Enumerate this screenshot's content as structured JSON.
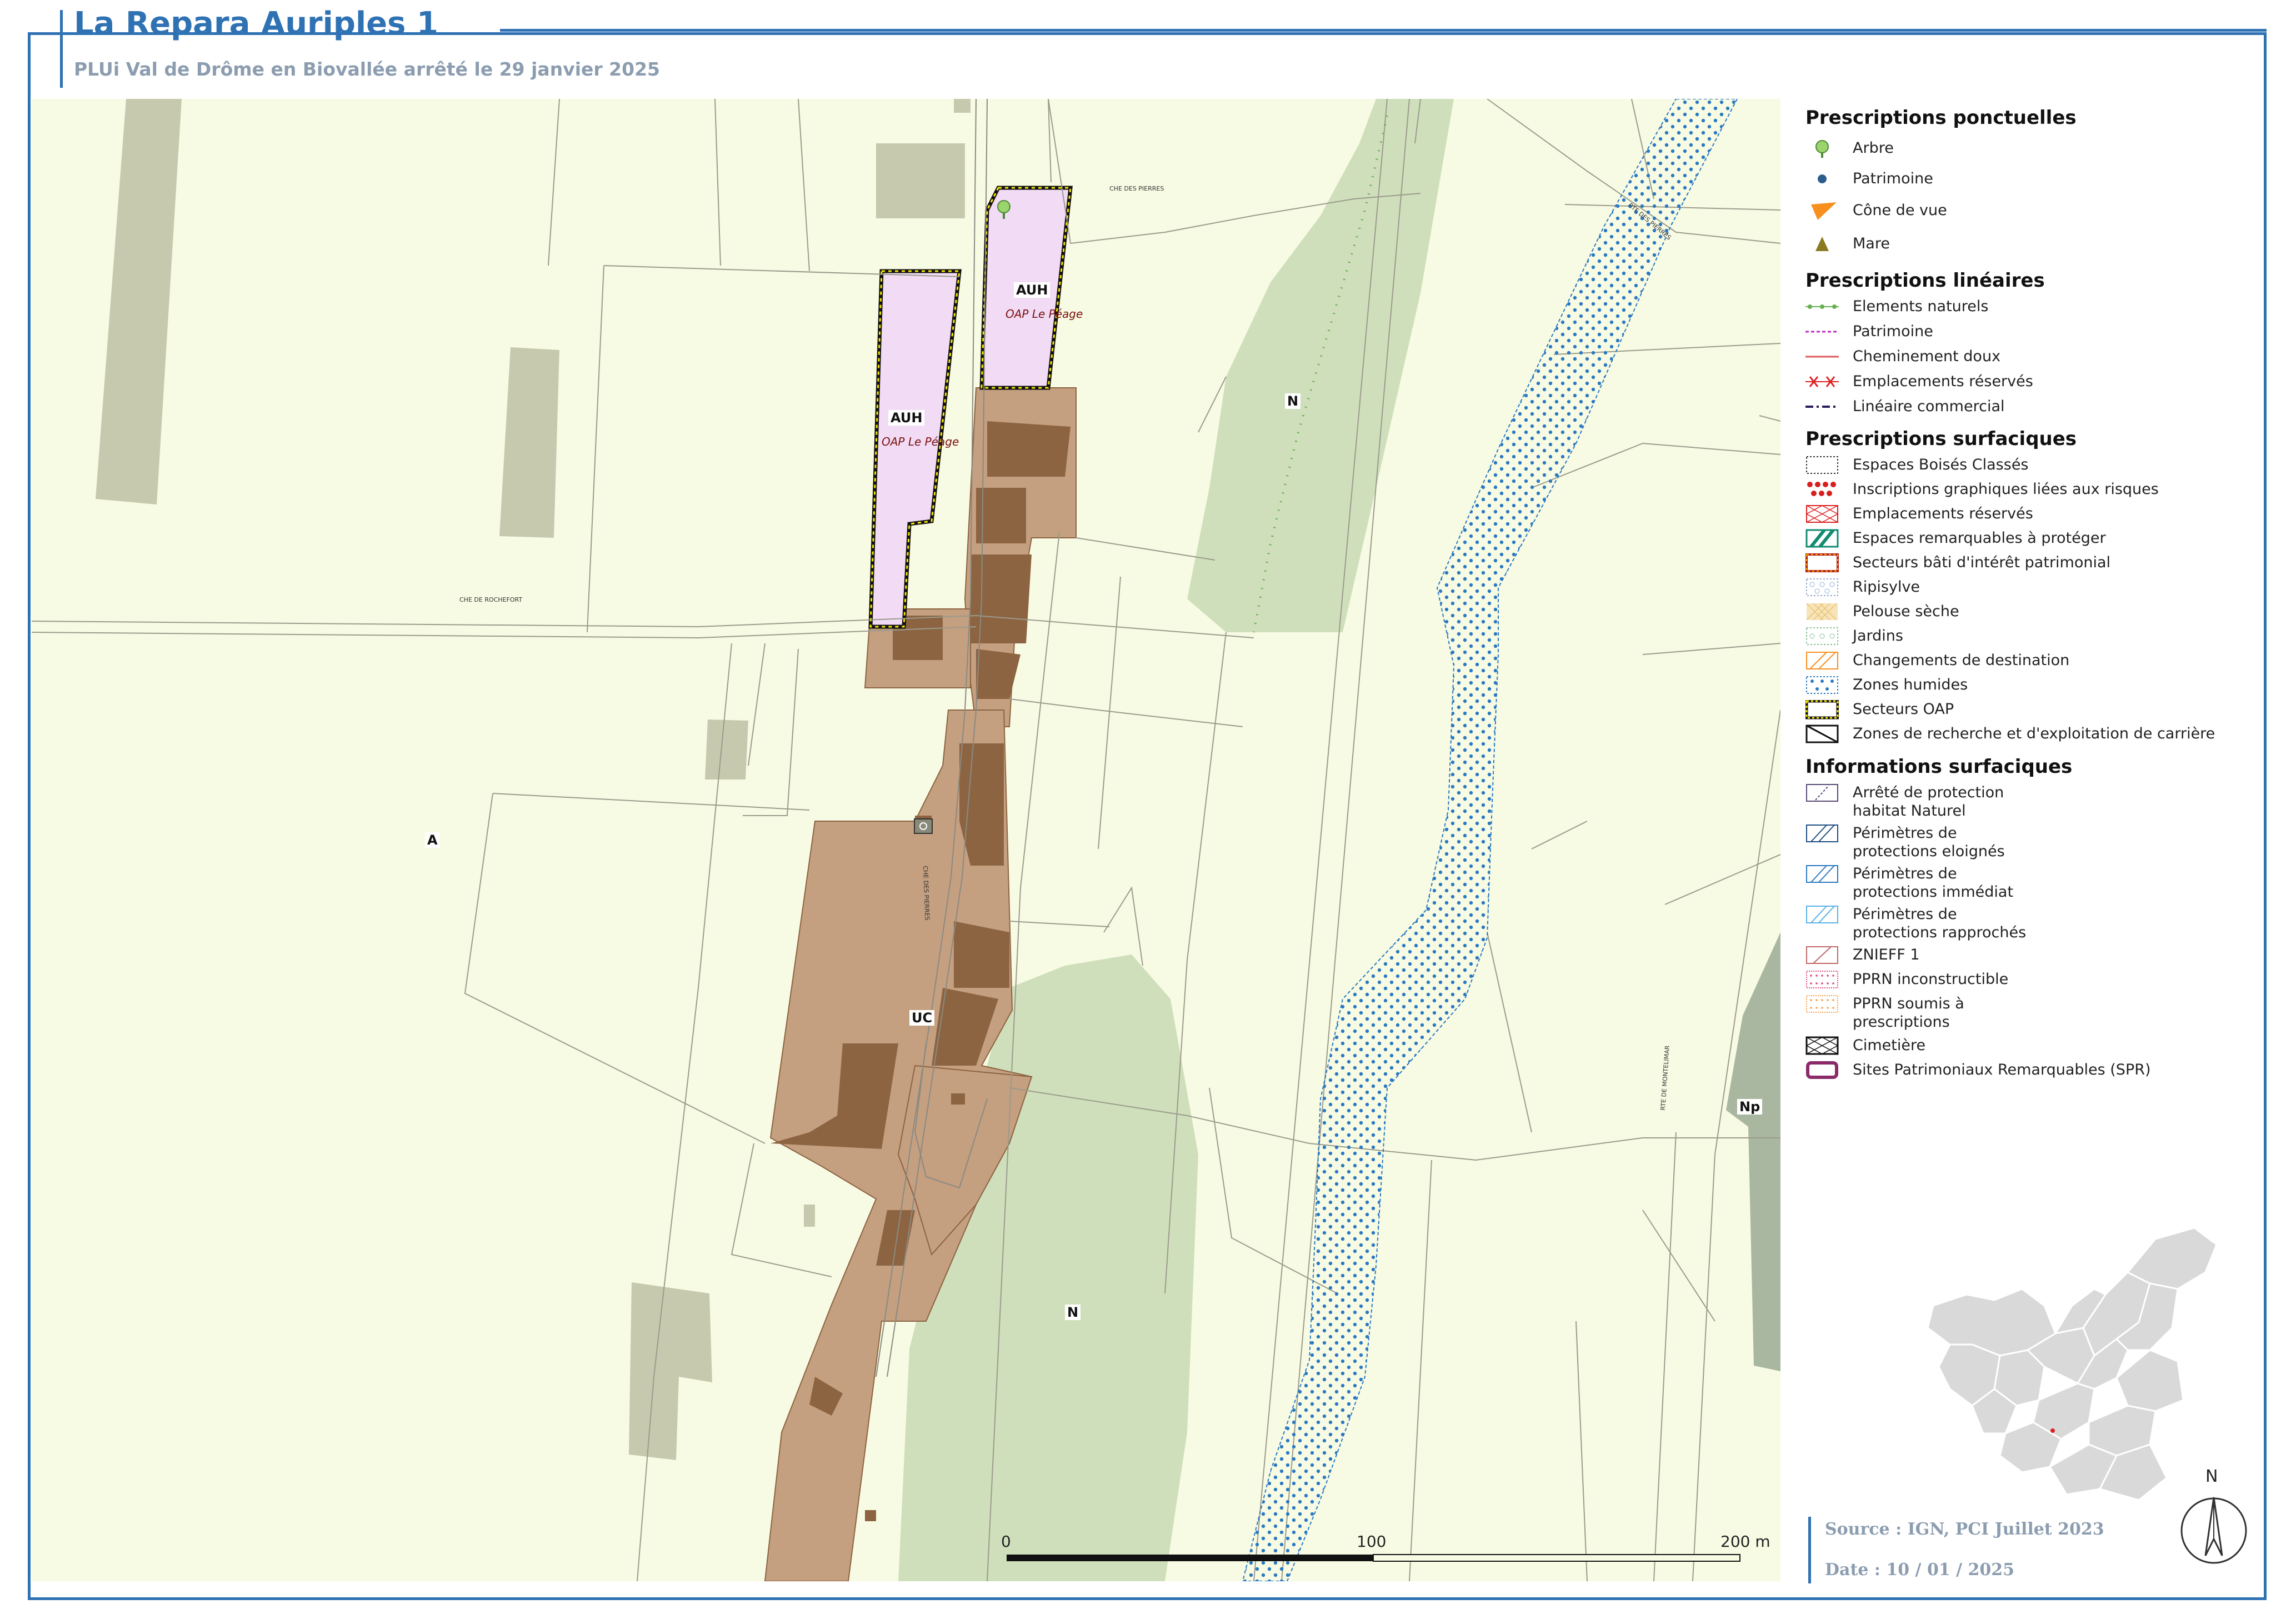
{
  "header": {
    "title": "La Repara Auriples 1",
    "subtitle": "PLUi Val de Drôme en Biovallée arrêté le 29 janvier 2025"
  },
  "map": {
    "zones": {
      "a": "A",
      "n_top": "N",
      "n_bottom": "N",
      "np": "Np",
      "uc": "UC",
      "auh_left": "AUH",
      "auh_right": "AUH",
      "oap_left": "OAP Le Péage",
      "oap_right": "OAP Le Péage"
    },
    "roads": {
      "rochefort": "CHE DE ROCHEFORT",
      "pierres": "CHE DES PIERRES",
      "pierres2": "CHE DES PIERRES",
      "vignes": "RTE DES PIERRES",
      "montelimar": "RTE DE MONTELIMAR"
    },
    "scale": {
      "zero": "0",
      "mid": "100",
      "end": "200 m"
    },
    "colors": {
      "background": "#f8fbe3",
      "natural": "#cfdfbb",
      "built": "#c49f80",
      "building": "#8c6442",
      "oap": "#f2dcf5",
      "oap_border": "#f5e600",
      "wetland": "#2b79c2"
    }
  },
  "legend": {
    "ponctuelles": {
      "title": "Prescriptions ponctuelles",
      "items": [
        "Arbre",
        "Patrimoine",
        "Cône de vue",
        "Mare"
      ]
    },
    "lineaires": {
      "title": "Prescriptions linéaires",
      "items": [
        "Elements naturels",
        "Patrimoine",
        "Cheminement doux",
        "Emplacements réservés",
        "Linéaire commercial"
      ]
    },
    "surfaciques": {
      "title": "Prescriptions surfaciques",
      "items": [
        "Espaces Boisés Classés",
        "Inscriptions graphiques liées aux risques",
        "Emplacements réservés",
        "Espaces remarquables à protéger",
        "Secteurs bâti d'intérêt patrimonial",
        "Ripisylve",
        "Pelouse sèche",
        "Jardins",
        "Changements de destination",
        "Zones humides",
        "Secteurs OAP",
        "Zones de recherche et d'exploitation de carrière"
      ]
    },
    "informations": {
      "title": "Informations surfaciques",
      "items": [
        [
          "Arrêté de protection",
          "habitat Naturel"
        ],
        [
          "Périmètres de",
          "protections eloignés"
        ],
        [
          "Périmètres de",
          "protections immédiat"
        ],
        [
          "Périmètres de",
          "protections rapprochés"
        ],
        [
          "ZNIEFF 1"
        ],
        [
          "PPRN inconstructible"
        ],
        [
          "PPRN soumis à",
          "prescriptions"
        ],
        [
          "Cimetière"
        ],
        [
          "Sites Patrimoniaux Remarquables (SPR)"
        ]
      ]
    }
  },
  "north": "N",
  "footer": {
    "source": "Source : IGN, PCI Juillet 2023",
    "date": "Date : 10 / 01 / 2025"
  }
}
